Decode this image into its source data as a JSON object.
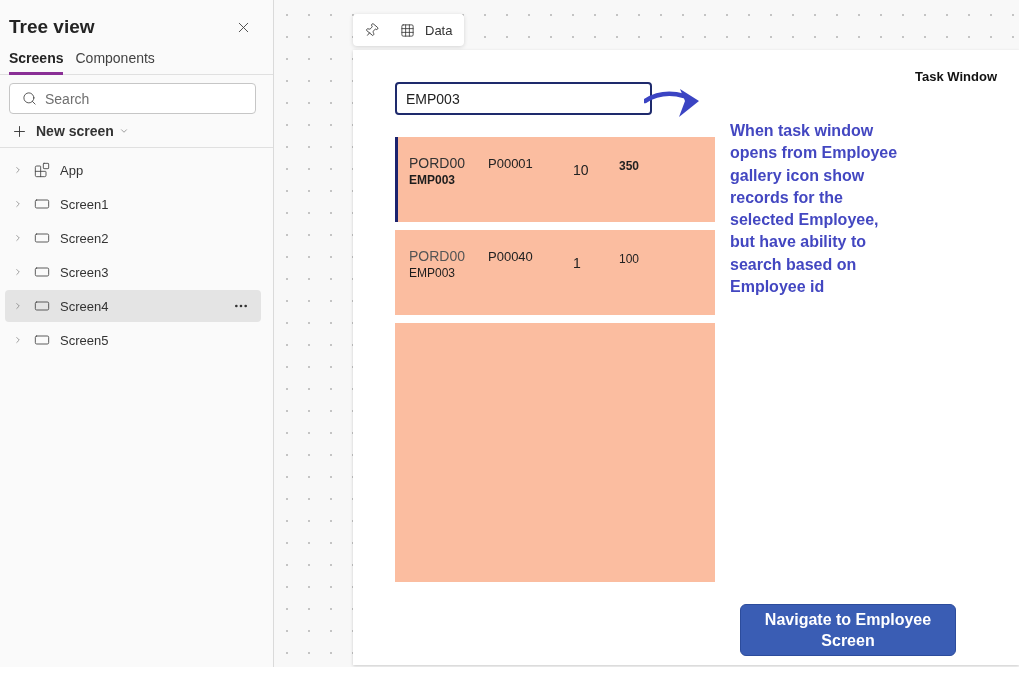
{
  "tree_view": {
    "title": "Tree view",
    "tabs": [
      {
        "label": "Screens",
        "selected": true
      },
      {
        "label": "Components",
        "selected": false
      }
    ],
    "search": {
      "placeholder": "Search"
    },
    "new_screen": {
      "label": "New screen"
    },
    "items": [
      {
        "label": "App",
        "kind": "app",
        "expanded": false,
        "selected": false
      },
      {
        "label": "Screen1",
        "kind": "screen",
        "expanded": false,
        "selected": false
      },
      {
        "label": "Screen2",
        "kind": "screen",
        "expanded": false,
        "selected": false
      },
      {
        "label": "Screen3",
        "kind": "screen",
        "expanded": false,
        "selected": false
      },
      {
        "label": "Screen4",
        "kind": "screen",
        "expanded": false,
        "selected": true
      },
      {
        "label": "Screen5",
        "kind": "screen",
        "expanded": false,
        "selected": false
      }
    ]
  },
  "canvas": {
    "toolbar": {
      "data_label": "Data"
    },
    "screen": {
      "title": "Task Window",
      "search": {
        "value": "EMP003"
      },
      "gallery": {
        "items": [
          {
            "title": "PORD00",
            "subtitle": "EMP003",
            "field_1": "P00001",
            "field_2": "10",
            "field_3": "350",
            "selected": true
          },
          {
            "title": "PORD00",
            "subtitle": "EMP003",
            "field_1": "P00040",
            "field_2": "1",
            "field_3": "100",
            "selected": false
          }
        ]
      },
      "annotation": "When task window opens from Employee gallery icon show records for the selected Employee, but have ability to search based on Employee id",
      "button": "Navigate to Employee Screen"
    }
  }
}
